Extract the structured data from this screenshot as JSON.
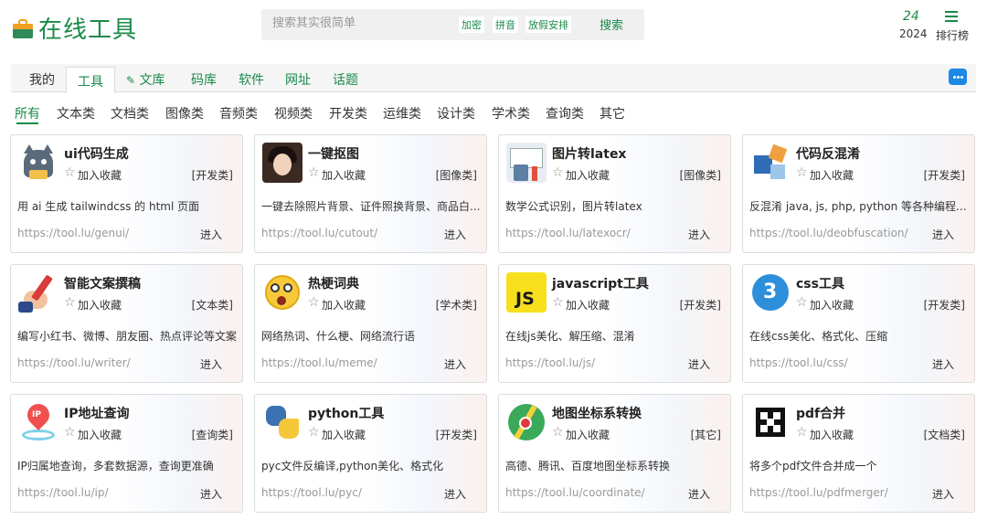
{
  "header": {
    "logo_text": "在线工具",
    "search": {
      "placeholder": "搜索其实很简单",
      "button": "搜索"
    },
    "quick_tags": [
      "加密",
      "拼音",
      "放假安排"
    ],
    "rank": {
      "number": "24",
      "year": "2024",
      "label": "排行榜"
    }
  },
  "nav": {
    "tabs": [
      "我的",
      "工具",
      "文库",
      "码库",
      "软件",
      "网址",
      "话题"
    ],
    "active": "工具"
  },
  "categories": {
    "items": [
      "所有",
      "文本类",
      "文档类",
      "图像类",
      "音频类",
      "视频类",
      "开发类",
      "运维类",
      "设计类",
      "学术类",
      "查询类",
      "其它"
    ],
    "active": "所有"
  },
  "common": {
    "fav_label": "加入收藏",
    "enter_label": "进入"
  },
  "cards": [
    {
      "title": "ui代码生成",
      "category": "[开发类]",
      "desc": "用 ai 生成 tailwindcss 的 html 页面",
      "url": "https://tool.lu/genui/",
      "icon": "cat-mascot-icon"
    },
    {
      "title": "一键抠图",
      "category": "[图像类]",
      "desc": "一键去除照片背景、证件照换背景、商品白...",
      "url": "https://tool.lu/cutout/",
      "icon": "portrait-photo-icon"
    },
    {
      "title": "图片转latex",
      "category": "[图像类]",
      "desc": "数学公式识别，图片转latex",
      "url": "https://tool.lu/latexocr/",
      "icon": "math-formula-icon"
    },
    {
      "title": "代码反混淆",
      "category": "[开发类]",
      "desc": "反混淆 java, js, php, python 等各种编程...",
      "url": "https://tool.lu/deobfuscation/",
      "icon": "code-blocks-icon"
    },
    {
      "title": "智能文案撰稿",
      "category": "[文本类]",
      "desc": "编写小红书、微博、朋友圈、热点评论等文案",
      "url": "https://tool.lu/writer/",
      "icon": "writing-hand-icon"
    },
    {
      "title": "热梗词典",
      "category": "[学术类]",
      "desc": "网络热词、什么梗、网络流行语",
      "url": "https://tool.lu/meme/",
      "icon": "shocked-emoji-icon"
    },
    {
      "title": "javascript工具",
      "category": "[开发类]",
      "desc": "在线js美化、解压缩、混淆",
      "url": "https://tool.lu/js/",
      "icon": "js-logo-icon"
    },
    {
      "title": "css工具",
      "category": "[开发类]",
      "desc": "在线css美化、格式化、压缩",
      "url": "https://tool.lu/css/",
      "icon": "css-logo-icon"
    },
    {
      "title": "IP地址查询",
      "category": "[查询类]",
      "desc": "IP归属地查询，多套数据源，查询更准确",
      "url": "https://tool.lu/ip/",
      "icon": "ip-location-pin-icon"
    },
    {
      "title": "python工具",
      "category": "[开发类]",
      "desc": "pyc文件反编译,python美化、格式化",
      "url": "https://tool.lu/pyc/",
      "icon": "python-logo-icon"
    },
    {
      "title": "地图坐标系转换",
      "category": "[其它]",
      "desc": "高德、腾讯、百度地图坐标系转换",
      "url": "https://tool.lu/coordinate/",
      "icon": "map-pin-icon"
    },
    {
      "title": "pdf合并",
      "category": "[文档类]",
      "desc": "将多个pdf文件合并成一个",
      "url": "https://tool.lu/pdfmerger/",
      "icon": "pdf-merge-icon"
    }
  ]
}
